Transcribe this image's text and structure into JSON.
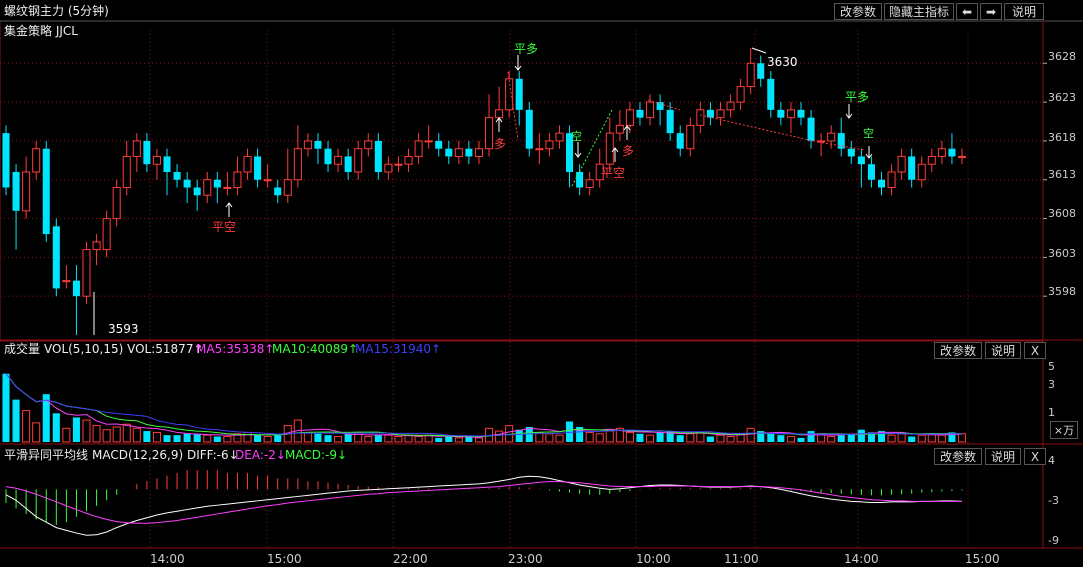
{
  "title": "螺纹钢主力 (5分钟)",
  "strategy": "集金策略 JJCL",
  "top_buttons": [
    "改参数",
    "隐藏主指标",
    "⬅",
    "➡",
    "说明"
  ],
  "colors": {
    "up": "#ff3c3c",
    "down": "#00e5ff",
    "grid": "#8c1013",
    "axis": "#cccccc",
    "ma5": "#ff40ff",
    "ma10": "#39ff39",
    "ma15": "#3f3fff",
    "dif": "#ffffff",
    "dea": "#ff40ff"
  },
  "price_axis": [
    "3628",
    "3623",
    "3618",
    "3613",
    "3608",
    "3603",
    "3598"
  ],
  "price_labels": {
    "high": "3630",
    "low": "3593"
  },
  "signals": [
    {
      "label": "平空",
      "color": "#ff3c3c"
    },
    {
      "label": "平多",
      "color": "#39ff39"
    },
    {
      "label": "多",
      "color": "#ff3c3c"
    },
    {
      "label": "空",
      "color": "#39ff39"
    },
    {
      "label": "平空",
      "color": "#ff3c3c"
    },
    {
      "label": "多",
      "color": "#ff3c3c"
    },
    {
      "label": "平多",
      "color": "#39ff39"
    },
    {
      "label": "空",
      "color": "#39ff39"
    }
  ],
  "volume": {
    "label": "成交量",
    "vol_info": "VOL(5,10,15) VOL:51877↑",
    "ma5": "MA5:35338↑",
    "ma10": "MA10:40089↑",
    "ma15": "MA15:31940↑",
    "axis": [
      "5",
      "3",
      "1"
    ],
    "unit": "×万",
    "buttons": [
      "改参数",
      "说明",
      "X"
    ]
  },
  "macd": {
    "label": "平滑异同平均线",
    "info": "MACD(12,26,9) DIFF:-6↓",
    "dea": "DEA:-2↓",
    "macd": "MACD:-9↓",
    "axis": [
      "4",
      "-3",
      "-9"
    ],
    "buttons": [
      "改参数",
      "说明",
      "X"
    ]
  },
  "time_axis": [
    "14:00",
    "15:00",
    "22:00",
    "23:00",
    "10:00",
    "11:00",
    "14:00",
    "15:00"
  ],
  "chart_data": {
    "type": "candlestick",
    "instrument": "螺纹钢主力",
    "interval": "5分钟",
    "candles": [
      [
        3619,
        3612,
        3620,
        3611
      ],
      [
        3614,
        3609,
        3615,
        3604
      ],
      [
        3609,
        3614,
        3616,
        3608
      ],
      [
        3614,
        3617,
        3618,
        3613
      ],
      [
        3617,
        3606,
        3618,
        3605
      ],
      [
        3607,
        3599,
        3608,
        3598
      ],
      [
        3600,
        3600,
        3602,
        3599
      ],
      [
        3600,
        3598,
        3602,
        3593
      ],
      [
        3598,
        3604,
        3605,
        3597
      ],
      [
        3604,
        3605,
        3606,
        3602
      ],
      [
        3604,
        3608,
        3609,
        3603
      ],
      [
        3608,
        3612,
        3613,
        3607
      ],
      [
        3612,
        3616,
        3618,
        3611
      ],
      [
        3616,
        3618,
        3619,
        3614
      ],
      [
        3618,
        3615,
        3619,
        3614
      ],
      [
        3615,
        3616,
        3617,
        3613
      ],
      [
        3616,
        3614,
        3617,
        3611
      ],
      [
        3614,
        3613,
        3615,
        3612
      ],
      [
        3613,
        3612,
        3614,
        3610
      ],
      [
        3612,
        3611,
        3613,
        3609
      ],
      [
        3611,
        3613,
        3614,
        3610
      ],
      [
        3613,
        3612,
        3614,
        3610
      ],
      [
        3612,
        3612,
        3614,
        3611
      ],
      [
        3612,
        3614,
        3616,
        3611
      ],
      [
        3614,
        3616,
        3617,
        3613
      ],
      [
        3616,
        3613,
        3617,
        3612
      ],
      [
        3613,
        3613,
        3615,
        3612
      ],
      [
        3612,
        3611,
        3613,
        3610
      ],
      [
        3611,
        3613,
        3617,
        3610
      ],
      [
        3613,
        3617,
        3620,
        3612
      ],
      [
        3617,
        3618,
        3619,
        3616
      ],
      [
        3618,
        3617,
        3619,
        3615
      ],
      [
        3617,
        3615,
        3618,
        3614
      ],
      [
        3615,
        3616,
        3617,
        3614
      ],
      [
        3616,
        3614,
        3617,
        3613
      ],
      [
        3614,
        3617,
        3618,
        3613
      ],
      [
        3617,
        3618,
        3619,
        3616
      ],
      [
        3618,
        3614,
        3619,
        3613
      ],
      [
        3614,
        3615,
        3616,
        3613
      ],
      [
        3615,
        3615,
        3616,
        3614
      ],
      [
        3615,
        3616,
        3617,
        3614
      ],
      [
        3616,
        3618,
        3619,
        3615
      ],
      [
        3618,
        3618,
        3620,
        3617
      ],
      [
        3618,
        3617,
        3619,
        3616
      ],
      [
        3617,
        3616,
        3618,
        3615
      ],
      [
        3616,
        3617,
        3618,
        3615
      ],
      [
        3617,
        3616,
        3618,
        3615
      ],
      [
        3616,
        3617,
        3618,
        3615
      ],
      [
        3617,
        3621,
        3624,
        3616
      ],
      [
        3621,
        3622,
        3625,
        3620
      ],
      [
        3622,
        3626,
        3627,
        3621
      ],
      [
        3626,
        3622,
        3627,
        3620
      ],
      [
        3622,
        3617,
        3623,
        3616
      ],
      [
        3617,
        3617,
        3619,
        3615
      ],
      [
        3617,
        3618,
        3619,
        3616
      ],
      [
        3618,
        3619,
        3620,
        3617
      ],
      [
        3619,
        3614,
        3620,
        3612
      ],
      [
        3614,
        3612,
        3615,
        3611
      ],
      [
        3612,
        3613,
        3614,
        3611
      ],
      [
        3613,
        3615,
        3617,
        3612
      ],
      [
        3615,
        3619,
        3621,
        3614
      ],
      [
        3619,
        3620,
        3622,
        3618
      ],
      [
        3620,
        3622,
        3623,
        3619
      ],
      [
        3622,
        3621,
        3623,
        3620
      ],
      [
        3621,
        3623,
        3624,
        3620
      ],
      [
        3623,
        3622,
        3624,
        3620
      ],
      [
        3622,
        3619,
        3623,
        3618
      ],
      [
        3619,
        3617,
        3620,
        3616
      ],
      [
        3617,
        3620,
        3621,
        3616
      ],
      [
        3620,
        3622,
        3623,
        3619
      ],
      [
        3622,
        3621,
        3623,
        3620
      ],
      [
        3621,
        3622,
        3623,
        3620
      ],
      [
        3622,
        3623,
        3624,
        3621
      ],
      [
        3623,
        3625,
        3626,
        3622
      ],
      [
        3625,
        3628,
        3630,
        3624
      ],
      [
        3628,
        3626,
        3629,
        3625
      ],
      [
        3626,
        3622,
        3627,
        3621
      ],
      [
        3622,
        3621,
        3623,
        3620
      ],
      [
        3621,
        3622,
        3623,
        3619
      ],
      [
        3622,
        3621,
        3623,
        3620
      ],
      [
        3621,
        3618,
        3622,
        3617
      ],
      [
        3618,
        3618,
        3619,
        3616
      ],
      [
        3618,
        3619,
        3620,
        3617
      ],
      [
        3619,
        3617,
        3621,
        3616
      ],
      [
        3617,
        3616,
        3618,
        3615
      ],
      [
        3616,
        3615,
        3617,
        3612
      ],
      [
        3615,
        3613,
        3616,
        3612
      ],
      [
        3613,
        3612,
        3614,
        3611
      ],
      [
        3612,
        3614,
        3615,
        3611
      ],
      [
        3614,
        3616,
        3617,
        3613
      ],
      [
        3616,
        3613,
        3617,
        3612
      ],
      [
        3613,
        3615,
        3616,
        3612
      ],
      [
        3615,
        3616,
        3617,
        3614
      ],
      [
        3616,
        3617,
        3618,
        3615
      ],
      [
        3617,
        3616,
        3619,
        3615
      ],
      [
        3616,
        3616,
        3617,
        3615
      ]
    ],
    "volume": [
      5.0,
      3.1,
      2.3,
      1.4,
      3.5,
      2.1,
      1.0,
      1.8,
      1.6,
      1.2,
      0.9,
      1.1,
      1.3,
      1.0,
      0.8,
      0.7,
      0.5,
      0.5,
      0.6,
      0.6,
      0.5,
      0.4,
      0.4,
      0.6,
      0.7,
      0.5,
      0.4,
      0.5,
      1.2,
      1.6,
      0.7,
      0.6,
      0.5,
      0.4,
      0.6,
      0.7,
      0.4,
      0.5,
      0.5,
      0.4,
      0.5,
      0.4,
      0.5,
      0.3,
      0.4,
      0.3,
      0.4,
      0.3,
      1.0,
      0.8,
      1.2,
      0.9,
      1.1,
      0.7,
      0.6,
      0.5,
      1.5,
      1.1,
      0.7,
      0.6,
      0.8,
      1.0,
      0.7,
      0.6,
      0.5,
      0.7,
      0.8,
      0.5,
      0.6,
      0.7,
      0.4,
      0.5,
      0.4,
      0.6,
      1.0,
      0.8,
      0.6,
      0.5,
      0.4,
      0.3,
      0.8,
      0.6,
      0.4,
      0.5,
      0.6,
      0.9,
      0.7,
      0.8,
      0.5,
      0.6,
      0.4,
      0.5,
      0.6,
      0.5,
      0.7,
      0.6
    ],
    "macd_hist": [
      -2.5,
      -3.5,
      -4.5,
      -5.5,
      -6,
      -6.5,
      -6,
      -5,
      -4,
      -3,
      -2,
      -1,
      0,
      1,
      1.5,
      2,
      2.5,
      3,
      3.5,
      3.5,
      3.5,
      3.5,
      3,
      3,
      3,
      2.5,
      2.5,
      2,
      2,
      2,
      1.5,
      1.5,
      1.2,
      1.0,
      0.8,
      0.6,
      0.5,
      0.4,
      0.3,
      0.3,
      0.2,
      0.2,
      0.2,
      0.1,
      0.1,
      0.1,
      0.1,
      0.1,
      0.2,
      0.3,
      0.4,
      0.4,
      0.3,
      0.1,
      -0.2,
      -0.4,
      -0.6,
      -0.8,
      -1.0,
      -1.0,
      -0.8,
      -0.5,
      -0.3,
      -0.1,
      0.1,
      0.2,
      0.2,
      0.2,
      0.2,
      0.2,
      0.2,
      0.2,
      0.2,
      0.2,
      0.3,
      0.2,
      0.1,
      0,
      -0.2,
      -0.3,
      -0.5,
      -0.6,
      -0.7,
      -0.8,
      -0.9,
      -1.0,
      -1.1,
      -1.1,
      -1.0,
      -0.9,
      -0.8,
      -0.6,
      -0.5,
      -0.4,
      -0.3,
      -0.2
    ],
    "dif": [
      -1,
      -2,
      -3.5,
      -5,
      -6,
      -7,
      -7.5,
      -8,
      -8.4,
      -8.3,
      -7.8,
      -7,
      -6.3,
      -5.7,
      -5.2,
      -4.7,
      -4.3,
      -4.0,
      -3.7,
      -3.4,
      -3.1,
      -2.9,
      -2.7,
      -2.5,
      -2.3,
      -2.1,
      -1.9,
      -1.7,
      -1.5,
      -1.3,
      -1.1,
      -0.9,
      -0.7,
      -0.5,
      -0.3,
      -0.2,
      -0.1,
      0,
      0.1,
      0.2,
      0.3,
      0.4,
      0.5,
      0.6,
      0.7,
      0.8,
      0.9,
      1.0,
      1.2,
      1.5,
      1.8,
      2.2,
      2.4,
      2.3,
      2.0,
      1.6,
      1.2,
      0.8,
      0.5,
      0.2,
      0,
      0.1,
      0.3,
      0.5,
      0.7,
      0.8,
      0.8,
      0.7,
      0.6,
      0.5,
      0.4,
      0.4,
      0.4,
      0.5,
      0.6,
      0.5,
      0.3,
      0,
      -0.4,
      -0.8,
      -1.2,
      -1.5,
      -1.8,
      -2.0,
      -2.2,
      -2.3,
      -2.4,
      -2.4,
      -2.3,
      -2.3,
      -2.3,
      -2.2,
      -2.2,
      -2.1,
      -2.1,
      -2.2
    ],
    "dea": [
      0.5,
      0.2,
      -0.3,
      -0.9,
      -1.6,
      -2.3,
      -3.0,
      -3.7,
      -4.4,
      -5.0,
      -5.5,
      -5.9,
      -6.1,
      -6.2,
      -6.2,
      -6.1,
      -5.9,
      -5.7,
      -5.4,
      -5.1,
      -4.8,
      -4.5,
      -4.2,
      -3.9,
      -3.6,
      -3.3,
      -3.0,
      -2.8,
      -2.5,
      -2.3,
      -2.1,
      -1.9,
      -1.7,
      -1.5,
      -1.3,
      -1.1,
      -0.9,
      -0.8,
      -0.6,
      -0.5,
      -0.4,
      -0.3,
      -0.2,
      -0.1,
      0,
      0.1,
      0.2,
      0.3,
      0.4,
      0.5,
      0.7,
      0.9,
      1.1,
      1.3,
      1.4,
      1.4,
      1.3,
      1.2,
      1.0,
      0.8,
      0.6,
      0.5,
      0.5,
      0.5,
      0.5,
      0.6,
      0.6,
      0.6,
      0.6,
      0.5,
      0.5,
      0.5,
      0.5,
      0.5,
      0.5,
      0.5,
      0.4,
      0.3,
      0.1,
      -0.1,
      -0.4,
      -0.7,
      -1.0,
      -1.3,
      -1.5,
      -1.7,
      -1.9,
      -2.0,
      -2.1,
      -2.1,
      -2.2,
      -2.2,
      -2.2,
      -2.2,
      -2.2,
      -2.2
    ],
    "price_range": [
      3593,
      3631
    ],
    "volume_range": [
      0,
      6
    ],
    "macd_range": [
      -10,
      5
    ]
  }
}
